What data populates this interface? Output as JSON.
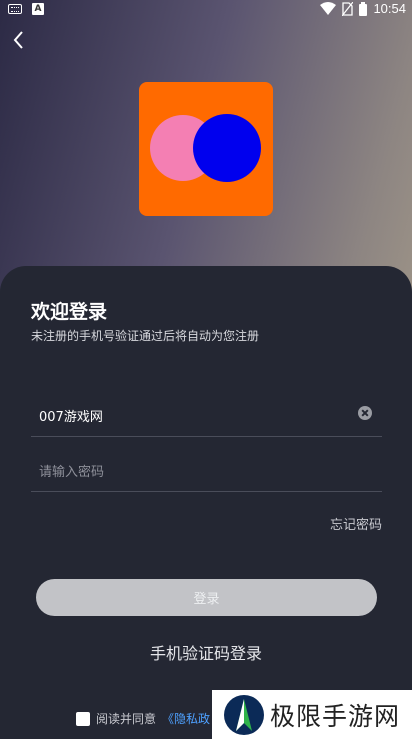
{
  "status_bar": {
    "time": "10:54",
    "left_icons": [
      "keyboard-icon",
      "app-a-icon"
    ],
    "right_icons": [
      "wifi-icon",
      "no-sim-icon",
      "battery-icon"
    ]
  },
  "header": {
    "back_icon": "chevron-left-icon"
  },
  "logo": {
    "bg_color": "#ff6a00",
    "circle_left_color": "#f47fb3",
    "circle_right_color": "#0000ee"
  },
  "login": {
    "title": "欢迎登录",
    "subtitle": "未注册的手机号验证通过后将自动为您注册",
    "account_value": "007游戏网",
    "password_placeholder": "请输入密码",
    "forgot_password": "忘记密码",
    "login_button": "登录",
    "sms_login": "手机验证码登录",
    "agreement_prefix": "阅读并同意",
    "privacy_link": "《隐私政"
  },
  "watermark": {
    "text": "极限手游网"
  },
  "colors": {
    "sheet_bg": "#242733",
    "button_disabled": "#c2c3c7",
    "link": "#4ea1ff"
  }
}
